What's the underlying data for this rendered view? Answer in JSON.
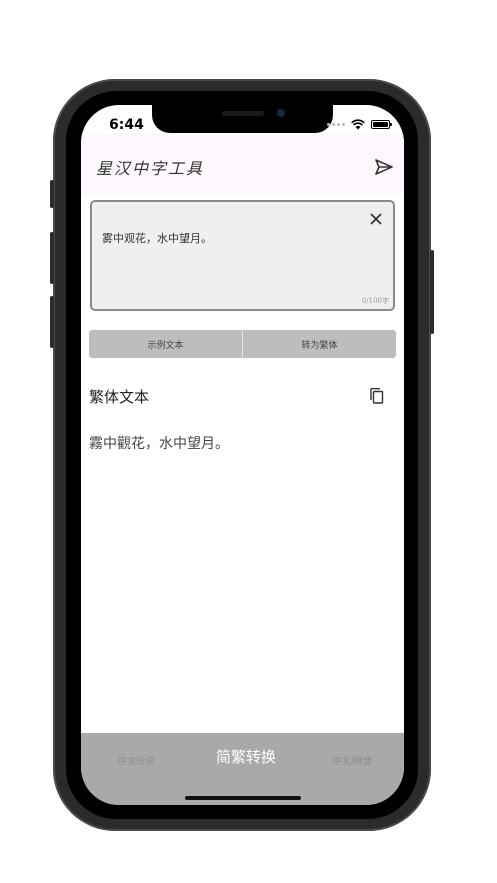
{
  "status_bar": {
    "time": "6:44"
  },
  "header": {
    "title": "星汉中字工具",
    "send_icon": "send-icon"
  },
  "input": {
    "text": "雾中观花，水中望月。",
    "counter": "0/100字",
    "clear_icon": "close-icon"
  },
  "buttons": {
    "sample": "示例文本",
    "convert": "转为繁体"
  },
  "result": {
    "title": "繁体文本",
    "text": "霧中觀花，水中望月。",
    "copy_icon": "copy-icon"
  },
  "tabs": [
    {
      "label": "中文分词"
    },
    {
      "label": "简繁转换"
    },
    {
      "label": "中文/拼音"
    }
  ]
}
